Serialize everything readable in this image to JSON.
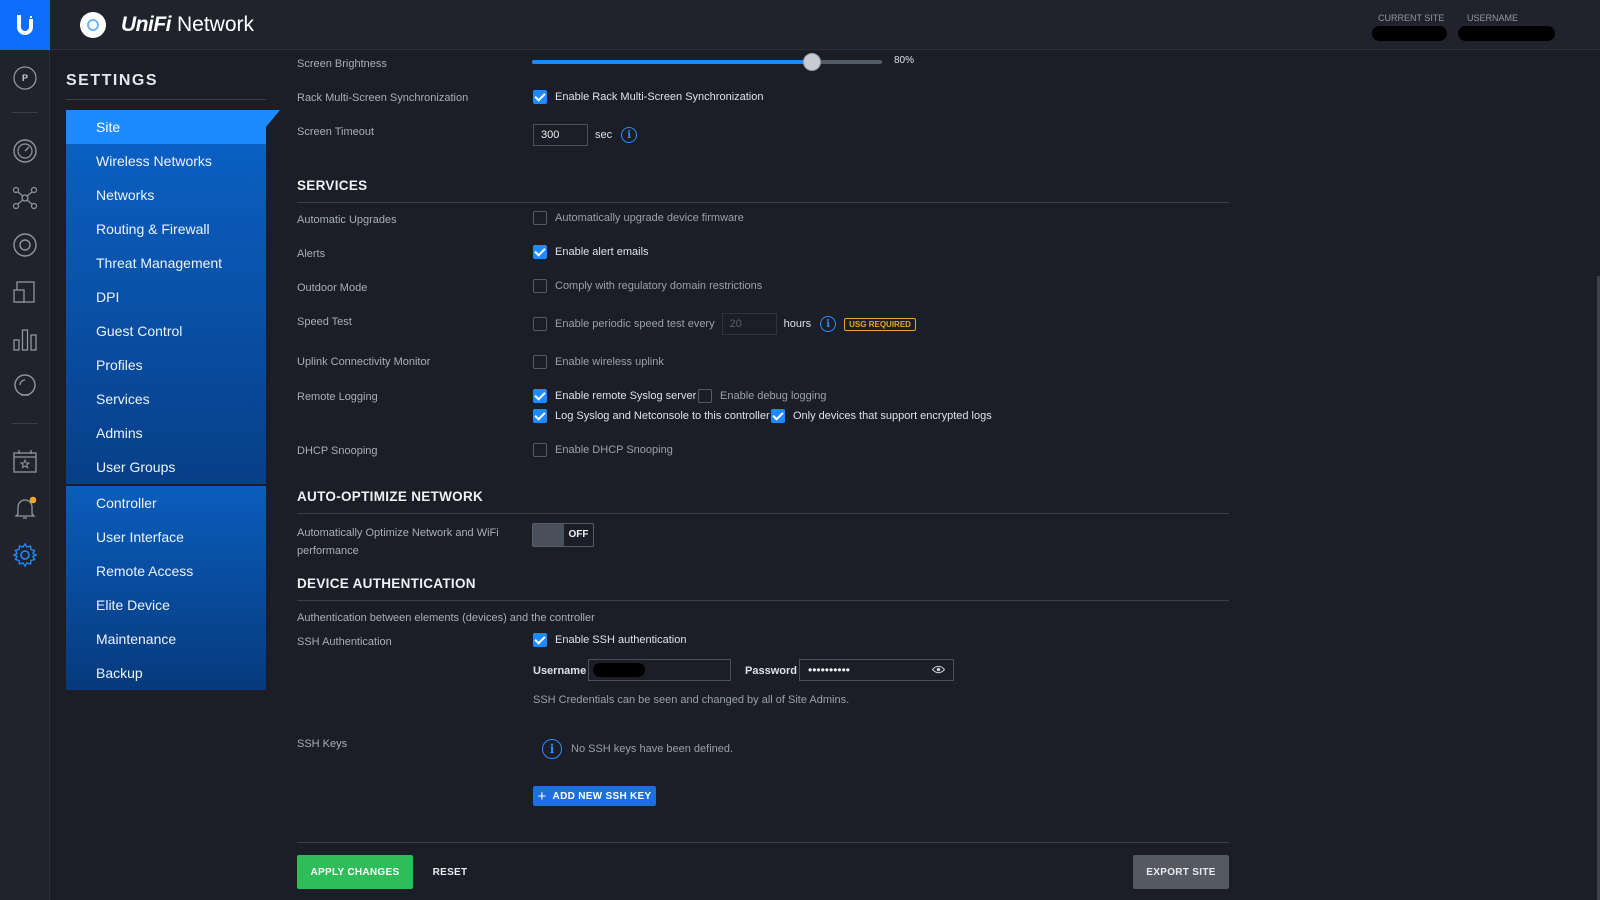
{
  "header": {
    "app_name_stylized": "UniFi",
    "app_name": "Network",
    "current_site_label": "CURRENT SITE",
    "username_label": "USERNAME"
  },
  "rail_icons": [
    "profile-badge-icon",
    "dashboard-icon",
    "topology-icon",
    "devices-icon",
    "clients-icon",
    "statistics-icon",
    "insights-icon",
    "events-icon",
    "alerts-icon",
    "settings-icon"
  ],
  "rail_profile_letter": "P",
  "settings": {
    "title": "SETTINGS",
    "site_group": [
      {
        "label": "Site",
        "active": true
      },
      {
        "label": "Wireless Networks"
      },
      {
        "label": "Networks"
      },
      {
        "label": "Routing & Firewall"
      },
      {
        "label": "Threat Management"
      },
      {
        "label": "DPI"
      },
      {
        "label": "Guest Control"
      },
      {
        "label": "Profiles"
      },
      {
        "label": "Services"
      },
      {
        "label": "Admins"
      },
      {
        "label": "User Groups"
      }
    ],
    "controller_group": [
      {
        "label": "Controller"
      },
      {
        "label": "User Interface"
      },
      {
        "label": "Remote Access"
      },
      {
        "label": "Elite Device"
      },
      {
        "label": "Maintenance"
      },
      {
        "label": "Backup"
      }
    ]
  },
  "display": {
    "brightness_label": "Screen Brightness",
    "brightness_value": 80,
    "brightness_text": "80%",
    "rack_sync_label": "Rack Multi-Screen Synchronization",
    "rack_sync_option": "Enable Rack Multi-Screen Synchronization",
    "timeout_label": "Screen Timeout",
    "timeout_value": "300",
    "timeout_unit": "sec"
  },
  "services": {
    "title": "SERVICES",
    "auto_upgrades_label": "Automatic Upgrades",
    "auto_upgrades_option": "Automatically upgrade device firmware",
    "alerts_label": "Alerts",
    "alerts_option": "Enable alert emails",
    "outdoor_label": "Outdoor Mode",
    "outdoor_option": "Comply with regulatory domain restrictions",
    "speedtest_label": "Speed Test",
    "speedtest_option": "Enable periodic speed test every",
    "speedtest_hours": "20",
    "speedtest_unit": "hours",
    "usg_badge": "USG REQUIRED",
    "uplink_label": "Uplink Connectivity Monitor",
    "uplink_option": "Enable wireless uplink",
    "remote_logging_label": "Remote Logging",
    "syslog_option": "Enable remote Syslog server",
    "debug_option": "Enable debug logging",
    "netconsole_option": "Log Syslog and Netconsole to this controller",
    "encrypted_option": "Only devices that support encrypted logs",
    "dhcp_label": "DHCP Snooping",
    "dhcp_option": "Enable DHCP Snooping"
  },
  "auto_optimize": {
    "title": "AUTO-OPTIMIZE NETWORK",
    "label_line1": "Automatically Optimize Network and WiFi",
    "label_line2": "performance",
    "toggle_text": "OFF"
  },
  "device_auth": {
    "title": "DEVICE AUTHENTICATION",
    "description": "Authentication between elements (devices) and the controller",
    "ssh_label": "SSH Authentication",
    "ssh_option": "Enable SSH authentication",
    "username_label": "Username",
    "password_label": "Password",
    "password_value": "••••••••••",
    "credentials_note": "SSH Credentials can be seen and changed by all of Site Admins.",
    "ssh_keys_label": "SSH Keys",
    "no_keys_text": "No SSH keys have been defined.",
    "add_key_button": "ADD NEW SSH KEY"
  },
  "footer": {
    "apply_button": "APPLY CHANGES",
    "reset_button": "RESET",
    "export_button": "EXPORT SITE"
  },
  "colors": {
    "accent": "#1d8bff",
    "apply_green": "#2ebd59",
    "badge_orange": "#e6a91f"
  }
}
